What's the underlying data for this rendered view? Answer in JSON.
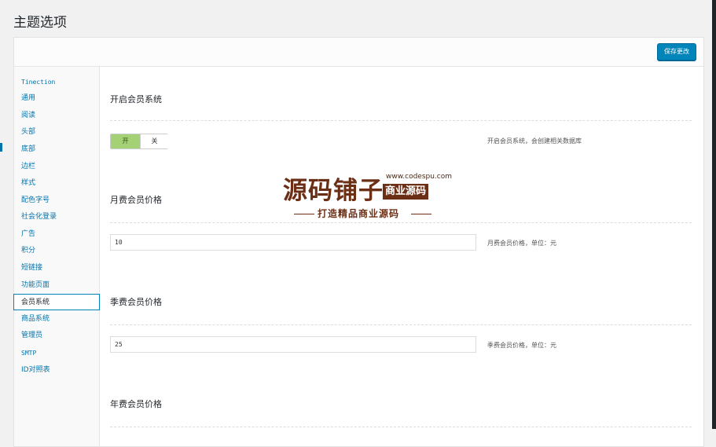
{
  "page": {
    "title": "主题选项"
  },
  "header": {
    "save_label": "保存更改"
  },
  "sidebar": {
    "items": [
      {
        "label": "Tinection"
      },
      {
        "label": "通用"
      },
      {
        "label": "阅读"
      },
      {
        "label": "头部"
      },
      {
        "label": "底部"
      },
      {
        "label": "边栏"
      },
      {
        "label": "样式"
      },
      {
        "label": "配色字号"
      },
      {
        "label": "社会化登录"
      },
      {
        "label": "广告"
      },
      {
        "label": "积分"
      },
      {
        "label": "短链接"
      },
      {
        "label": "功能页面"
      },
      {
        "label": "会员系统",
        "active": true
      },
      {
        "label": "商品系统"
      },
      {
        "label": "管理员"
      },
      {
        "label": "SMTP"
      },
      {
        "label": "ID对照表"
      }
    ]
  },
  "main": {
    "member_system": {
      "title": "开启会员系统",
      "toggle_on": "开",
      "toggle_off": "关",
      "description": "开启会员系统，会创建相关数据库"
    },
    "monthly": {
      "title": "月费会员价格",
      "value": "10",
      "description": "月费会员价格，单位：元"
    },
    "quarterly": {
      "title": "季费会员价格",
      "value": "25",
      "description": "季费会员价格，单位：元"
    },
    "yearly": {
      "title": "年费会员价格"
    }
  },
  "watermark": {
    "logo": "源码铺子",
    "url": "www.codespu.com",
    "tag": "商业源码",
    "slogan": "打造精品商业源码"
  }
}
